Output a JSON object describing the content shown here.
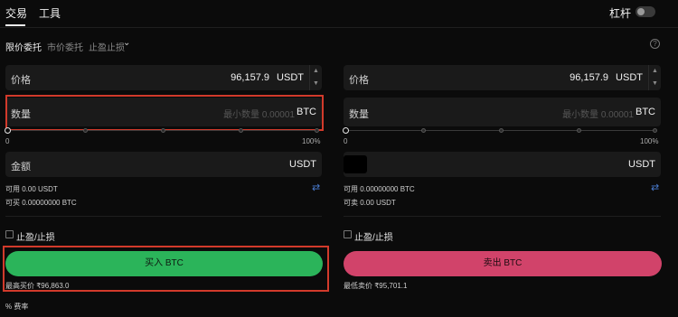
{
  "nav": {
    "trade": "交易",
    "tools": "工具",
    "leverage": "杠杆"
  },
  "order_types": {
    "limit": "限价委托",
    "market": "市价委托",
    "tpsl": "止盈止损"
  },
  "buy": {
    "price_label": "价格",
    "price_value": "96,157.9",
    "price_unit": "USDT",
    "qty_label": "数量",
    "qty_placeholder": "最小数量 0.00001",
    "qty_unit": "BTC",
    "slider_min": "0",
    "slider_max": "100%",
    "amount_label": "金额",
    "amount_unit": "USDT",
    "available": "可用 0.00 USDT",
    "can_buy": "可买 0.00000000 BTC",
    "tpsl_label": "止盈/止损",
    "button": "买入 BTC",
    "est_price": "最高买价 ₹96,863.0"
  },
  "sell": {
    "price_label": "价格",
    "price_value": "96,157.9",
    "price_unit": "USDT",
    "qty_label": "数量",
    "qty_placeholder": "最小数量 0.00001",
    "qty_unit": "BTC",
    "slider_min": "0",
    "slider_max": "100%",
    "amount_unit": "USDT",
    "available": "可用 0.00000000 BTC",
    "can_sell": "可卖 0.00 USDT",
    "tpsl_label": "止盈/止损",
    "button": "卖出 BTC",
    "est_price": "最低卖价 ₹95,701.1"
  },
  "footer": {
    "fee": "% 费率"
  },
  "icons": {
    "info": "info-icon",
    "swap": "swap-icon",
    "chevron": "chevron-down-icon"
  },
  "colors": {
    "buy": "#2bb45a",
    "sell": "#d1436a",
    "highlight": "#d23a2b",
    "swap": "#4a7bd0"
  }
}
